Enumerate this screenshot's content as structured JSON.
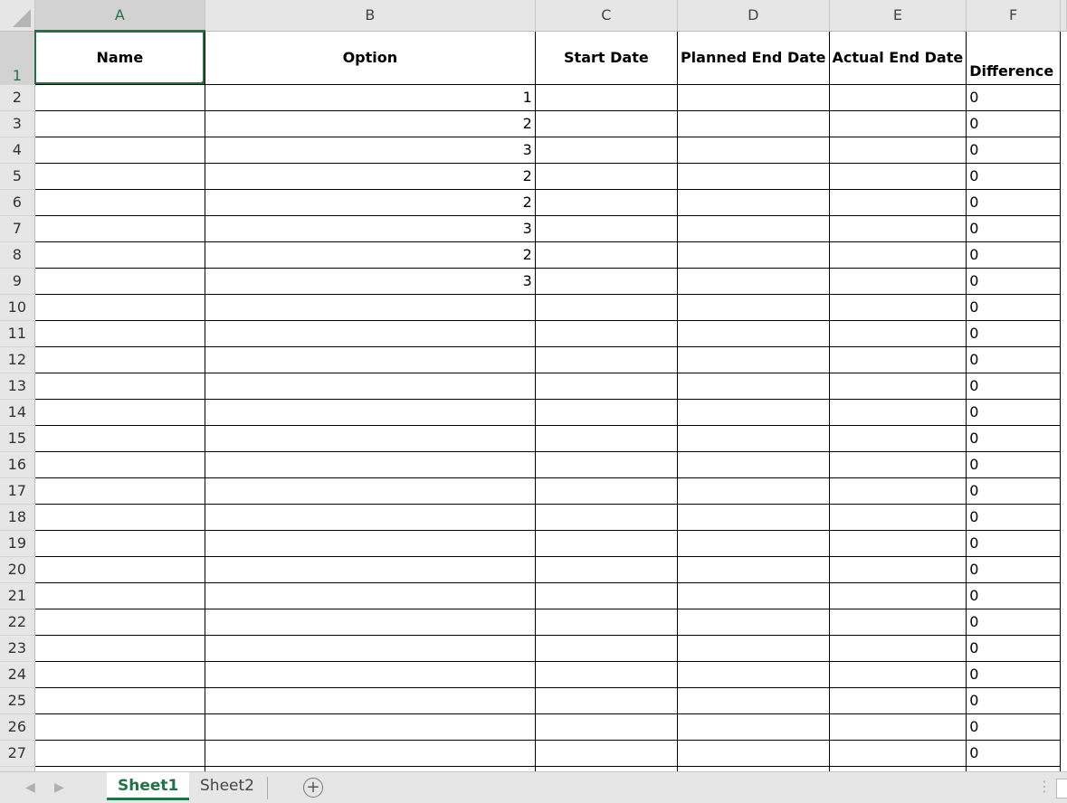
{
  "columns": [
    "A",
    "B",
    "C",
    "D",
    "E",
    "F"
  ],
  "headers": [
    "Name",
    "Option",
    "Start Date",
    "Planned End Date",
    "Actual End Date",
    "Difference"
  ],
  "rows": [
    {
      "n": "2",
      "option": "1",
      "difference": "0"
    },
    {
      "n": "3",
      "option": "2",
      "difference": "0"
    },
    {
      "n": "4",
      "option": "3",
      "difference": "0"
    },
    {
      "n": "5",
      "option": "2",
      "difference": "0"
    },
    {
      "n": "6",
      "option": "2",
      "difference": "0"
    },
    {
      "n": "7",
      "option": "3",
      "difference": "0"
    },
    {
      "n": "8",
      "option": "2",
      "difference": "0"
    },
    {
      "n": "9",
      "option": "3",
      "difference": "0"
    },
    {
      "n": "10",
      "option": "",
      "difference": "0"
    },
    {
      "n": "11",
      "option": "",
      "difference": "0"
    },
    {
      "n": "12",
      "option": "",
      "difference": "0"
    },
    {
      "n": "13",
      "option": "",
      "difference": "0"
    },
    {
      "n": "14",
      "option": "",
      "difference": "0"
    },
    {
      "n": "15",
      "option": "",
      "difference": "0"
    },
    {
      "n": "16",
      "option": "",
      "difference": "0"
    },
    {
      "n": "17",
      "option": "",
      "difference": "0"
    },
    {
      "n": "18",
      "option": "",
      "difference": "0"
    },
    {
      "n": "19",
      "option": "",
      "difference": "0"
    },
    {
      "n": "20",
      "option": "",
      "difference": "0"
    },
    {
      "n": "21",
      "option": "",
      "difference": "0"
    },
    {
      "n": "22",
      "option": "",
      "difference": "0"
    },
    {
      "n": "23",
      "option": "",
      "difference": "0"
    },
    {
      "n": "24",
      "option": "",
      "difference": "0"
    },
    {
      "n": "25",
      "option": "",
      "difference": "0"
    },
    {
      "n": "26",
      "option": "",
      "difference": "0"
    },
    {
      "n": "27",
      "option": "",
      "difference": "0"
    }
  ],
  "row1_label": "1",
  "sheets": [
    {
      "label": "Sheet1",
      "active": true
    },
    {
      "label": "Sheet2",
      "active": false
    }
  ],
  "add_sheet_icon": "plus-circle-icon",
  "accent_color": "#217346"
}
